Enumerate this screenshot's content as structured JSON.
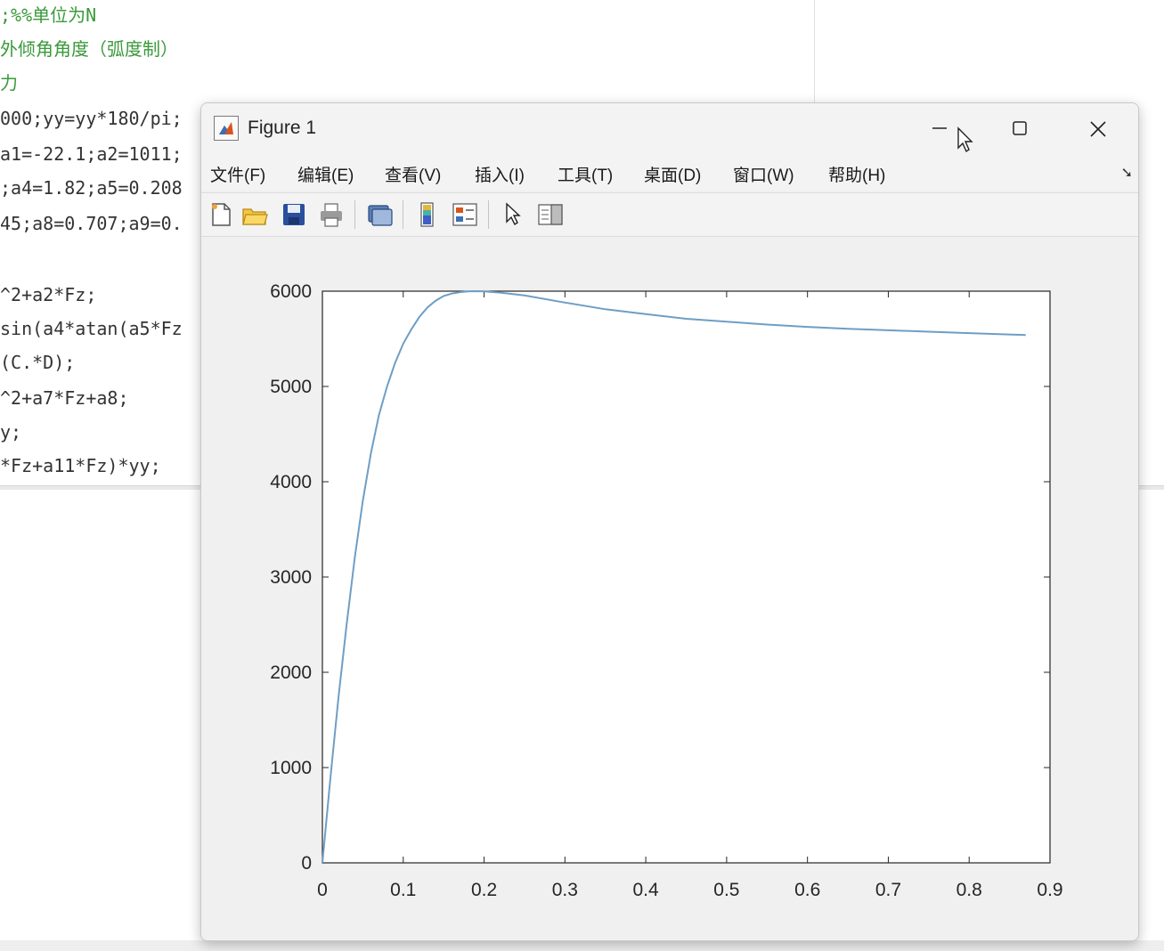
{
  "editor": {
    "code_lines": [
      {
        "text": ";%%单位为N",
        "kind": "comment"
      },
      {
        "text": "外倾角角度（弧度制）",
        "kind": "comment"
      },
      {
        "text": "力",
        "kind": "comment"
      },
      {
        "text": "000;yy=yy*180/pi;",
        "kind": "code"
      },
      {
        "text": "a1=-22.1;a2=1011;",
        "kind": "code"
      },
      {
        "text": ";a4=1.82;a5=0.208",
        "kind": "code"
      },
      {
        "text": "45;a8=0.707;a9=0.",
        "kind": "code"
      },
      {
        "text": "",
        "kind": "code"
      },
      {
        "text": "^2+a2*Fz;",
        "kind": "code"
      },
      {
        "text": "sin(a4*atan(a5*Fz",
        "kind": "code"
      },
      {
        "text": "(C.*D);",
        "kind": "code"
      },
      {
        "text": "^2+a7*Fz+a8;",
        "kind": "code"
      },
      {
        "text": "y;",
        "kind": "code"
      },
      {
        "text": "*Fz+a11*Fz)*yy;",
        "kind": "code"
      }
    ]
  },
  "figure": {
    "title": "Figure 1",
    "app_icon": "matlab-figure-icon",
    "window_buttons": {
      "minimize_icon": "minimize-icon",
      "maximize_icon": "maximize-icon",
      "close_icon": "close-icon"
    },
    "menu": [
      {
        "id": "file",
        "label": "文件(F)"
      },
      {
        "id": "edit",
        "label": "编辑(E)"
      },
      {
        "id": "view",
        "label": "查看(V)"
      },
      {
        "id": "insert",
        "label": "插入(I)"
      },
      {
        "id": "tools",
        "label": "工具(T)"
      },
      {
        "id": "desktop",
        "label": "桌面(D)"
      },
      {
        "id": "window",
        "label": "窗口(W)"
      },
      {
        "id": "help",
        "label": "帮助(H)"
      }
    ],
    "toolbar": [
      {
        "id": "new",
        "icon": "new-figure-icon"
      },
      {
        "id": "open",
        "icon": "open-file-icon"
      },
      {
        "id": "save",
        "icon": "save-icon"
      },
      {
        "id": "print",
        "icon": "print-icon"
      },
      {
        "id": "link",
        "icon": "link-plot-icon"
      },
      {
        "id": "colorbar",
        "icon": "colorbar-icon"
      },
      {
        "id": "legend",
        "icon": "legend-icon"
      },
      {
        "id": "edit_plot",
        "icon": "edit-plot-pointer-icon"
      },
      {
        "id": "property",
        "icon": "property-inspector-icon"
      }
    ]
  },
  "colors": {
    "line": "#6e9ec5",
    "axes": "#262626",
    "comment": "#3a9a3a"
  },
  "chart_data": {
    "type": "line",
    "title": "",
    "xlabel": "",
    "ylabel": "",
    "xlim": [
      0,
      0.9
    ],
    "ylim": [
      0,
      6000
    ],
    "xticks": [
      0,
      0.1,
      0.2,
      0.3,
      0.4,
      0.5,
      0.6,
      0.7,
      0.8,
      0.9
    ],
    "yticks": [
      0,
      1000,
      2000,
      3000,
      4000,
      5000,
      6000
    ],
    "xtick_labels": [
      "0",
      "0.1",
      "0.2",
      "0.3",
      "0.4",
      "0.5",
      "0.6",
      "0.7",
      "0.8",
      "0.9"
    ],
    "ytick_labels": [
      "0",
      "1000",
      "2000",
      "3000",
      "4000",
      "5000",
      "6000"
    ],
    "grid": false,
    "series": [
      {
        "x": [
          0,
          0.01,
          0.02,
          0.03,
          0.04,
          0.05,
          0.06,
          0.07,
          0.08,
          0.09,
          0.1,
          0.11,
          0.12,
          0.13,
          0.14,
          0.15,
          0.16,
          0.17,
          0.18,
          0.19,
          0.2,
          0.22,
          0.25,
          0.3,
          0.35,
          0.4,
          0.45,
          0.5,
          0.55,
          0.6,
          0.65,
          0.7,
          0.75,
          0.8,
          0.87
        ],
        "y": [
          0,
          900,
          1750,
          2500,
          3200,
          3800,
          4300,
          4700,
          5000,
          5250,
          5450,
          5600,
          5730,
          5830,
          5900,
          5950,
          5975,
          5990,
          5998,
          6000,
          5998,
          5985,
          5955,
          5880,
          5810,
          5760,
          5710,
          5680,
          5650,
          5625,
          5605,
          5590,
          5575,
          5560,
          5540
        ]
      }
    ]
  }
}
